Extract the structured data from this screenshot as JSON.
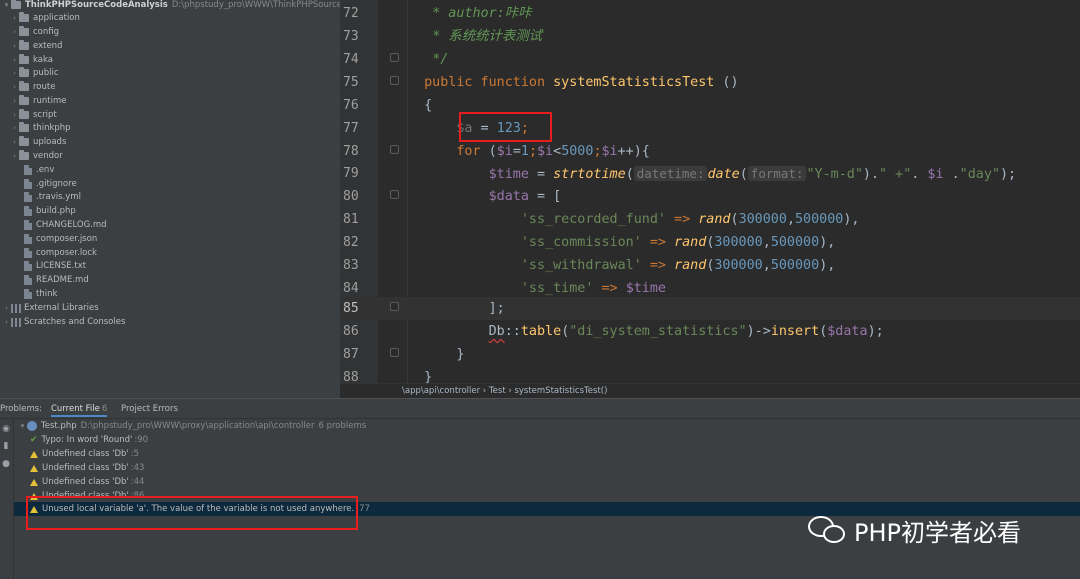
{
  "project": {
    "name": "ThinkPHPSourceCodeAnalysis",
    "path": "D:\\phpstudy_pro\\WWW\\ThinkPHPSourceCode",
    "folders": [
      "application",
      "config",
      "extend",
      "kaka",
      "public",
      "route",
      "runtime",
      "script",
      "thinkphp",
      "uploads",
      "vendor"
    ],
    "files": [
      ".env",
      ".gitignore",
      ".travis.yml",
      "build.php",
      "CHANGELOG.md",
      "composer.json",
      "composer.lock",
      "LICENSE.txt",
      "README.md",
      "think"
    ],
    "extra": [
      "External Libraries",
      "Scratches and Consoles"
    ]
  },
  "editor": {
    "line_numbers": [
      "72",
      "73",
      "74",
      "75",
      "76",
      "77",
      "78",
      "79",
      "80",
      "81",
      "82",
      "83",
      "84",
      "85",
      "86",
      "87",
      "88"
    ],
    "current_line": "85",
    "code": {
      "l72": "* author:咔咔",
      "l73": "* 系统统计表测试",
      "l74": "*/",
      "l75_kw": "public function",
      "l75_fn": "systemStatisticsTest",
      "l75_rest": " ()",
      "l76": "{",
      "l77_var": "$a",
      "l77_op": " = ",
      "l77_num": "123",
      "l77_end": ";",
      "l78_kw": "for",
      "l78_a": " (",
      "l78_v1": "$i",
      "l78_b": "=",
      "l78_n1": "1",
      "l78_c": ";",
      "l78_v2": "$i",
      "l78_d": "<",
      "l78_n2": "5000",
      "l78_e": ";",
      "l78_v3": "$i",
      "l78_f": "++",
      "l78_g": "){",
      "l79_var": "$time",
      "l79_op": " = ",
      "l79_fn": "strtotime",
      "l79_p": "(",
      "l79_hint1": "datetime:",
      "l79_fn2": "date",
      "l79_p2": "(",
      "l79_hint2": "format:",
      "l79_str1": "\"Y-m-d\"",
      "l79_cat1": ").",
      "l79_str2": "\" +\"",
      "l79_cat2": ". ",
      "l79_var2": "$i",
      "l79_cat3": " .",
      "l79_str3": "\"day\"",
      "l79_end": ");",
      "l80_var": "$data",
      "l80_rest": " = [",
      "rows": [
        {
          "key": "'ss_recorded_fund'",
          "fn": "rand",
          "a": "300000",
          "b": "500000"
        },
        {
          "key": "'ss_commission'",
          "fn": "rand",
          "a": "300000",
          "b": "500000"
        },
        {
          "key": "'ss_withdrawal'",
          "fn": "rand",
          "a": "300000",
          "b": "500000"
        }
      ],
      "arrow": " => ",
      "l84_key": "'ss_time'",
      "l84_var": "$time",
      "l85": "];",
      "l86_cls": "Db",
      "l86_op": "::",
      "l86_fn": "table",
      "l86_p": "(",
      "l86_str": "\"di_system_statistics\"",
      "l86_arrow": ")->",
      "l86_fn2": "insert",
      "l86_p2": "(",
      "l86_var": "$data",
      "l86_end": ");",
      "l87": "}",
      "l88": "}"
    },
    "breadcrumb": "\\app\\api\\controller  ›  Test  ›  systemStatisticsTest()"
  },
  "problems": {
    "label": "Problems:",
    "tabs": [
      {
        "label": "Current File",
        "count": "6"
      },
      {
        "label": "Project Errors",
        "count": ""
      }
    ],
    "file": "Test.php",
    "file_path": "D:\\phpstudy_pro\\WWW\\proxy\\application\\api\\controller",
    "file_count": "6 problems",
    "items": [
      {
        "type": "typo",
        "text": "Typo: In word 'Round'",
        "loc": ":90"
      },
      {
        "type": "warning",
        "text": "Undefined class 'Db'",
        "loc": ":5"
      },
      {
        "type": "warning",
        "text": "Undefined class 'Db'",
        "loc": ":43"
      },
      {
        "type": "warning",
        "text": "Undefined class 'Db'",
        "loc": ":44"
      },
      {
        "type": "warning",
        "text": "Undefined class 'Db'",
        "loc": ":86"
      },
      {
        "type": "warning",
        "text": "Unused local variable 'a'. The value of the variable is not used anywhere.",
        "loc": ":77"
      }
    ]
  },
  "watermark": "PHP初学者必看",
  "colors": {
    "keyword": "#cc7832",
    "function": "#ffc66d",
    "variable": "#9876aa",
    "number": "#6897bb",
    "string": "#6a8759",
    "highlight": "#e81e1e"
  }
}
